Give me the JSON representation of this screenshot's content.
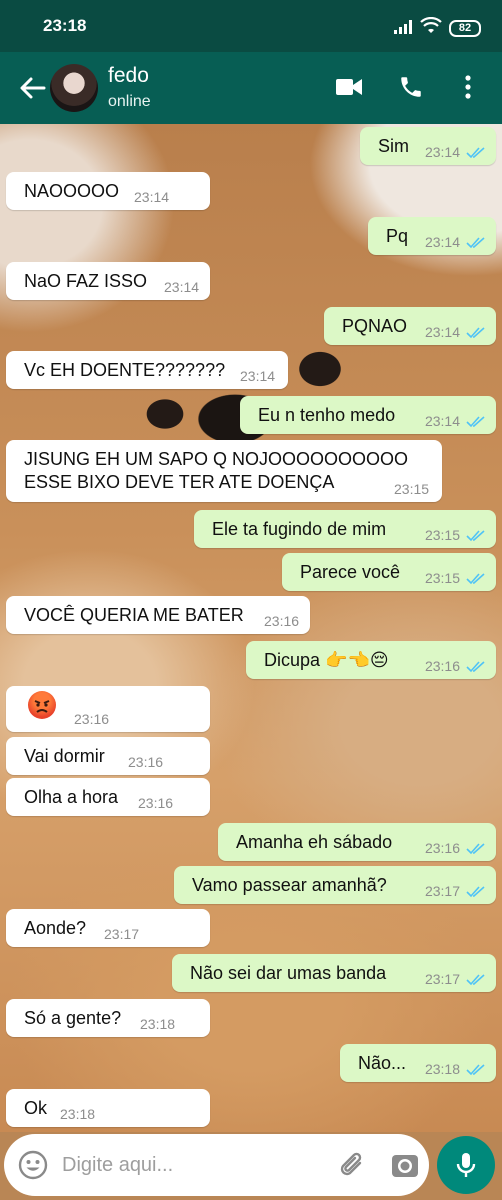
{
  "status_bar": {
    "time": "23:18",
    "battery": "82"
  },
  "header": {
    "name": "fedo",
    "status": "online"
  },
  "messages": [
    {
      "dir": "out",
      "text": "Sim",
      "time": "23:14"
    },
    {
      "dir": "in",
      "text": "NAOOOOO",
      "time": "23:14"
    },
    {
      "dir": "out",
      "text": "Pq",
      "time": "23:14"
    },
    {
      "dir": "in",
      "text": "NaO FAZ ISSO",
      "time": "23:14"
    },
    {
      "dir": "out",
      "text": "PQNAO",
      "time": "23:14"
    },
    {
      "dir": "in",
      "text": "Vc EH DOENTE???????",
      "time": "23:14"
    },
    {
      "dir": "out",
      "text": "Eu n tenho medo",
      "time": "23:14"
    },
    {
      "dir": "in",
      "text": "JISUNG EH UM SAPO Q NOJOOOOOOOOOO ESSE BIXO DEVE TER ATE DOENÇA",
      "time": "23:15"
    },
    {
      "dir": "out",
      "text": "Ele ta fugindo de mim",
      "time": "23:15"
    },
    {
      "dir": "out",
      "text": "Parece você",
      "time": "23:15"
    },
    {
      "dir": "in",
      "text": "VOCÊ QUERIA ME BATER",
      "time": "23:16"
    },
    {
      "dir": "out",
      "text": "Dicupa 👉👈😔",
      "time": "23:16"
    },
    {
      "dir": "in",
      "text": "",
      "time": "23:16",
      "emoji": "angry-face"
    },
    {
      "dir": "in",
      "text": "Vai dormir",
      "time": "23:16"
    },
    {
      "dir": "in",
      "text": "Olha a hora",
      "time": "23:16"
    },
    {
      "dir": "out",
      "text": "Amanha eh sábado",
      "time": "23:16"
    },
    {
      "dir": "out",
      "text": "Vamo passear amanhã?",
      "time": "23:17"
    },
    {
      "dir": "in",
      "text": "Aonde?",
      "time": "23:17"
    },
    {
      "dir": "out",
      "text": "Não sei dar umas banda",
      "time": "23:17"
    },
    {
      "dir": "in",
      "text": "Só a gente?",
      "time": "23:18"
    },
    {
      "dir": "out",
      "text": "Não...",
      "time": "23:18"
    },
    {
      "dir": "in",
      "text": "Ok",
      "time": "23:18"
    }
  ],
  "input": {
    "placeholder": "Digite aqui..."
  },
  "colors": {
    "header": "#075e54",
    "status_bar": "#0a4b42",
    "outgoing": "#dcf8c6",
    "incoming": "#ffffff",
    "mic": "#00897b",
    "read_ticks": "#4fc3f7"
  }
}
